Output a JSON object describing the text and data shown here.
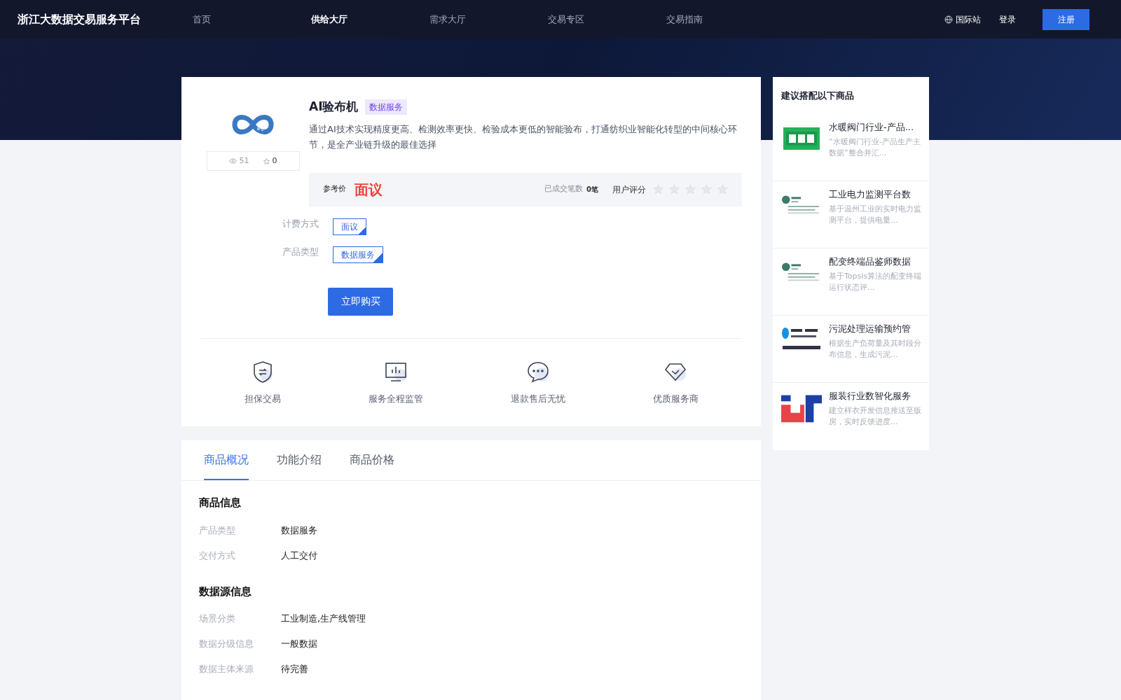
{
  "header": {
    "brand": "浙江大数据交易服务平台",
    "nav": [
      {
        "label": "首页",
        "selected": false
      },
      {
        "label": "供给大厅",
        "selected": true
      },
      {
        "label": "需求大厅",
        "selected": false
      },
      {
        "label": "交易专区",
        "selected": false
      },
      {
        "label": "交易指南",
        "selected": false
      }
    ],
    "intl": "国际站",
    "login": "登录",
    "register": "注册"
  },
  "product": {
    "title": "AI验布机",
    "tag": "数据服务",
    "description": "通过AI技术实现精度更高、检测效率更快、检验成本更低的智能验布，打通纺织业智能化转型的中间核心环节，是全产业链升级的最佳选择",
    "views": "51",
    "favorites": "0",
    "price_label": "参考价",
    "price": "面议",
    "deals_label": "已成交笔数",
    "deals": "0笔",
    "rating_label": "用户评分",
    "stars": 0,
    "options": [
      {
        "label": "计费方式",
        "value": "面议"
      },
      {
        "label": "产品类型",
        "value": "数据服务"
      }
    ],
    "buy": "立即购买",
    "guarantees": [
      {
        "kind": "shield",
        "label": "担保交易"
      },
      {
        "kind": "monitor",
        "label": "服务全程监管"
      },
      {
        "kind": "chat",
        "label": "退款售后无忧"
      },
      {
        "kind": "diamond",
        "label": "优质服务商"
      }
    ]
  },
  "tabs": [
    {
      "label": "商品概况",
      "selected": true
    },
    {
      "label": "功能介绍",
      "selected": false
    },
    {
      "label": "商品价格",
      "selected": false
    }
  ],
  "sections": [
    {
      "title": "商品信息",
      "rows": [
        {
          "label": "产品类型",
          "value": "数据服务"
        },
        {
          "label": "交付方式",
          "value": "人工交付"
        }
      ]
    },
    {
      "title": "数据源信息",
      "rows": [
        {
          "label": "场景分类",
          "value": "工业制造,生产线管理"
        },
        {
          "label": "数据分级信息",
          "value": "一般数据"
        },
        {
          "label": "数据主体来源",
          "value": "待完善"
        }
      ]
    }
  ],
  "recommend": {
    "title": "建议搭配以下商品",
    "items": [
      {
        "kind": "green",
        "title": "水暖阀门行业-产品...",
        "description": "“水暖阀门行业-产品生产主数据”整合并汇..."
      },
      {
        "kind": "grid",
        "title": "工业电力监测平台数",
        "description": "基于温州工业的实时电力监测平台，提供电量..."
      },
      {
        "kind": "grid",
        "title": "配变终端品鉴师数据",
        "description": "基于Topsis算法的配变终端运行状态评..."
      },
      {
        "kind": "blue",
        "title": "污泥处理运输预约管",
        "description": "根据生产负荷量及其时段分布信息，生成污泥..."
      },
      {
        "kind": "letters",
        "title": "服装行业数智化服务",
        "description": "建立样衣开发信息推送至版房，实时反馈进度..."
      }
    ]
  }
}
